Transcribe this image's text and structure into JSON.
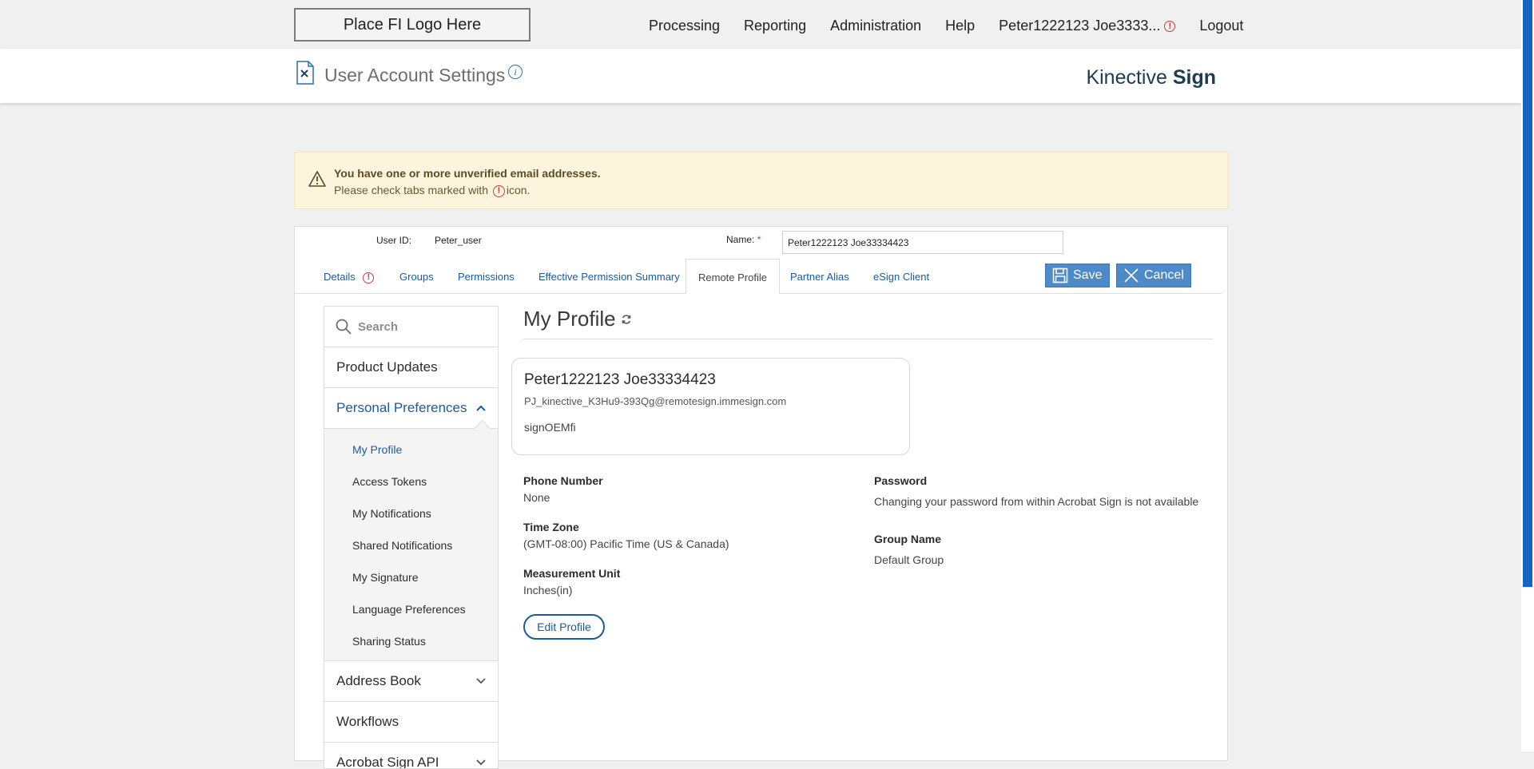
{
  "topbar": {
    "logo_text": "Place FI Logo Here",
    "nav": [
      "Processing",
      "Reporting",
      "Administration",
      "Help"
    ],
    "user_name": "Peter1222123 Joe3333...",
    "logout": "Logout"
  },
  "header": {
    "title": "User Account Settings",
    "brand_light": "Kinective ",
    "brand_bold": "Sign"
  },
  "warning": {
    "title": "You have one or more unverified email addresses.",
    "sub_before": "Please check tabs marked with",
    "sub_after": "icon."
  },
  "form": {
    "user_id_label": "User ID:",
    "user_id_value": "Peter_user",
    "name_label": "Name:",
    "required_mark": "*",
    "name_value": "Peter1222123 Joe33334423"
  },
  "tabs": {
    "details": "Details",
    "groups": "Groups",
    "permissions": "Permissions",
    "effective": "Effective Permission Summary",
    "remote": "Remote Profile",
    "partner": "Partner Alias",
    "esign": "eSign Client"
  },
  "buttons": {
    "save": "Save",
    "cancel": "Cancel"
  },
  "sidebar": {
    "search_placeholder": "Search",
    "product_updates": "Product Updates",
    "personal_preferences": "Personal Preferences",
    "sub": [
      "My Profile",
      "Access Tokens",
      "My Notifications",
      "Shared Notifications",
      "My Signature",
      "Language Preferences",
      "Sharing Status"
    ],
    "address_book": "Address Book",
    "workflows": "Workflows",
    "acrobat_api": "Acrobat Sign API"
  },
  "profile": {
    "heading": "My Profile",
    "card_name": "Peter1222123 Joe33334423",
    "card_email": "PJ_kinective_K3Hu9-393Qg@remotesign.immesign.com",
    "card_org": "signOEMfi",
    "phone_label": "Phone Number",
    "phone_value": "None",
    "tz_label": "Time Zone",
    "tz_value": "(GMT-08:00) Pacific Time (US & Canada)",
    "unit_label": "Measurement Unit",
    "unit_value": "Inches(in)",
    "password_label": "Password",
    "password_value": "Changing your password from within Acrobat Sign is not available",
    "group_label": "Group Name",
    "group_value": "Default Group",
    "edit_button": "Edit Profile"
  },
  "colors": {
    "accent": "#1b5a9c",
    "alert": "#d7373f",
    "warning_bg": "#fdf4dd",
    "button": "#4d8ac7"
  },
  "icons": [
    "page-settings-icon",
    "info-icon",
    "warning-icon",
    "alert-circle-icon",
    "save-disk-icon",
    "close-x-icon",
    "search-icon",
    "chevron-up-icon",
    "chevron-down-icon",
    "refresh-icon"
  ]
}
